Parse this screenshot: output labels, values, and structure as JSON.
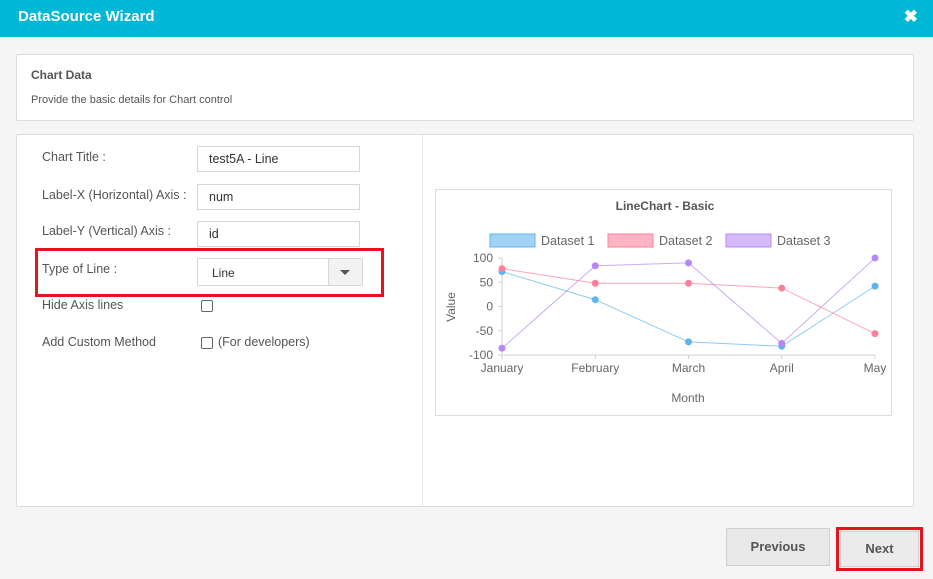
{
  "window": {
    "title": "DataSource Wizard",
    "close_icon": "close-icon"
  },
  "info": {
    "heading": "Chart Data",
    "description": "Provide the basic details for Chart control"
  },
  "form": {
    "chart_title_label": "Chart Title :",
    "chart_title_value": "test5A - Line",
    "label_x_label": "Label-X (Horizontal) Axis :",
    "label_x_value": "num",
    "label_y_label": "Label-Y (Vertical) Axis :",
    "label_y_value": "id",
    "type_of_line_label": "Type of Line :",
    "type_of_line_value": "Line",
    "hide_axis_label": "Hide Axis lines",
    "hide_axis_checked": false,
    "custom_method_label": "Add Custom Method",
    "custom_method_hint": "(For developers)",
    "custom_method_checked": false
  },
  "highlight_color": "#e3141c",
  "chart_data": {
    "type": "line",
    "title": "LineChart - Basic",
    "xlabel": "Month",
    "ylabel": "Value",
    "categories": [
      "January",
      "February",
      "March",
      "April",
      "May"
    ],
    "ylim": [
      -100,
      100
    ],
    "yticks": [
      100,
      50,
      0,
      -50,
      -100
    ],
    "legend_position": "top",
    "grid": false,
    "series": [
      {
        "name": "Dataset 1",
        "values": [
          72,
          14,
          -73,
          -82,
          42
        ],
        "color": "#5cb6ed",
        "legend_fill": "#9fd2f4"
      },
      {
        "name": "Dataset 2",
        "values": [
          78,
          48,
          48,
          38,
          -56
        ],
        "color": "#ff7f9b",
        "legend_fill": "#ffb4c4"
      },
      {
        "name": "Dataset 3",
        "values": [
          -86,
          84,
          90,
          -76,
          100
        ],
        "color": "#b787f7",
        "legend_fill": "#d5bbfa"
      }
    ]
  },
  "footer": {
    "previous_label": "Previous",
    "next_label": "Next"
  }
}
